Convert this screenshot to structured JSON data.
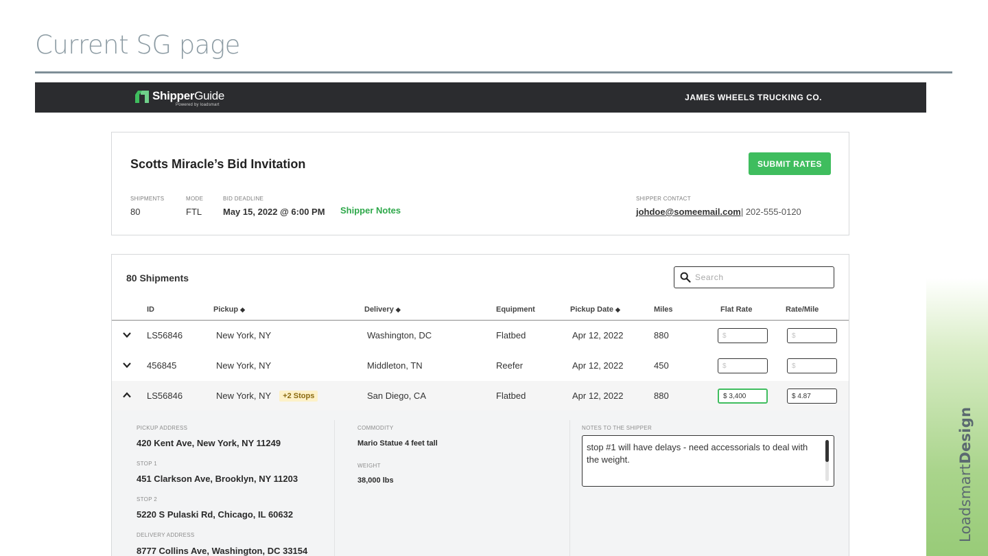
{
  "slide": {
    "title": "Current SG page",
    "brand_light": "Loadsmart",
    "brand_bold": "Design"
  },
  "colors": {
    "header_bg": "#2b2c2f",
    "accent_green": "#3fbd5e",
    "link_green": "#2ea84a",
    "slide_title": "#8c9ba3"
  },
  "header": {
    "logo_bold": "Shipper",
    "logo_thin": "Guide",
    "logo_sub": "Powered by loadsmart",
    "company": "JAMES WHEELS TRUCKING CO."
  },
  "bid": {
    "title": "Scotts Miracle’s Bid Invitation",
    "submit_label": "SUBMIT RATES",
    "shipments_label": "SHIPMENTS",
    "shipments_value": "80",
    "mode_label": "MODE",
    "mode_value": "FTL",
    "deadline_label": "BID DEADLINE",
    "deadline_value": "May 15, 2022 @ 6:00 PM",
    "notes_link": "Shipper Notes",
    "contact_label": "SHIPPER CONTACT",
    "contact_email": "johdoe@someemail.com",
    "contact_phone": "| 202-555-0120"
  },
  "shipments": {
    "title": "80 Shipments",
    "search_placeholder": "Search",
    "columns": {
      "id": "ID",
      "pickup": "Pickup",
      "delivery": "Delivery",
      "equipment": "Equipment",
      "pickup_date": "Pickup Date",
      "miles": "Miles",
      "flat_rate": "Flat Rate",
      "rate_mile": "Rate/Mile"
    },
    "rate_placeholder": "$",
    "rows": [
      {
        "id": "LS56846",
        "pickup": "New York, NY",
        "delivery": "Washington, DC",
        "equipment": "Flatbed",
        "pickup_date": "Apr 12, 2022",
        "miles": "880",
        "flat_rate": "",
        "rate_mile": "",
        "expanded": false
      },
      {
        "id": "456845",
        "pickup": "New York, NY",
        "delivery": "Middleton, TN",
        "equipment": "Reefer",
        "pickup_date": "Apr 12, 2022",
        "miles": "450",
        "flat_rate": "",
        "rate_mile": "",
        "expanded": false
      },
      {
        "id": "LS56846",
        "pickup": "New York, NY",
        "stops": "+2 Stops",
        "delivery": "San Diego, CA",
        "equipment": "Flatbed",
        "pickup_date": "Apr 12, 2022",
        "miles": "880",
        "flat_rate": "$ 3,400",
        "rate_mile": "$ 4.87",
        "expanded": true
      }
    ],
    "detail": {
      "pickup_label": "PICKUP ADDRESS",
      "pickup_value": "420 Kent Ave, New York, NY 11249",
      "stop1_label": "STOP 1",
      "stop1_value": "451 Clarkson Ave, Brooklyn, NY 11203",
      "stop2_label": "STOP 2",
      "stop2_value": "5220 S Pulaski Rd, Chicago, IL 60632",
      "delivery_label": "DELIVERY ADDRESS",
      "delivery_value": "8777 Collins Ave, Washington, DC 33154",
      "commodity_label": "COMMODITY",
      "commodity_value": "Mario Statue 4 feet tall",
      "weight_label": "WEIGHT",
      "weight_value": "38,000 lbs",
      "notes_label": "NOTES TO THE SHIPPER",
      "notes_value": "stop #1 will have delays - need accessorials to deal with the weight."
    }
  }
}
